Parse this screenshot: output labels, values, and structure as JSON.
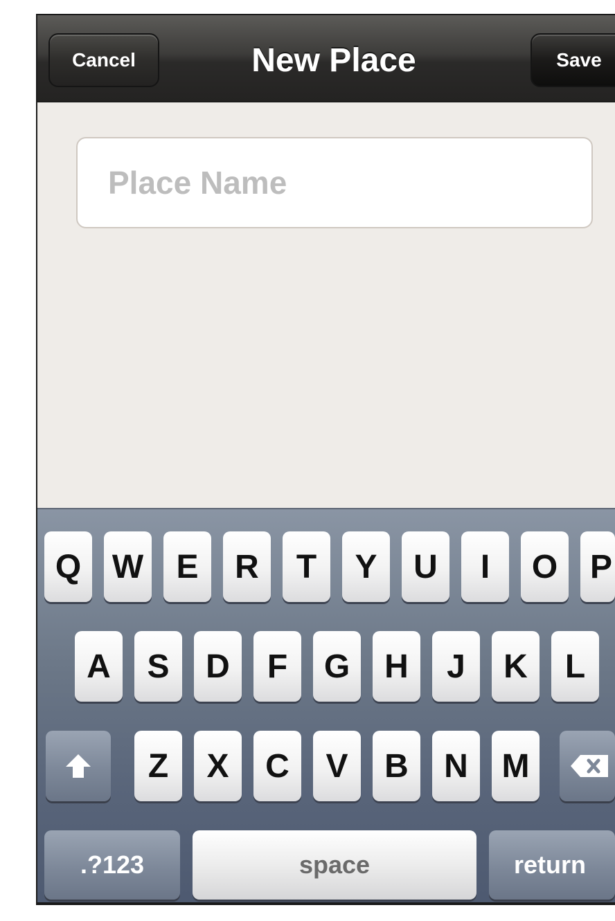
{
  "navbar": {
    "cancel_label": "Cancel",
    "title": "New Place",
    "save_label": "Save"
  },
  "form": {
    "place_name_value": "",
    "place_name_placeholder": "Place Name"
  },
  "keyboard": {
    "row1": [
      "Q",
      "W",
      "E",
      "R",
      "T",
      "Y",
      "U",
      "I",
      "O",
      "P"
    ],
    "row2": [
      "A",
      "S",
      "D",
      "F",
      "G",
      "H",
      "J",
      "K",
      "L"
    ],
    "row3": [
      "Z",
      "X",
      "C",
      "V",
      "B",
      "N",
      "M"
    ],
    "shift_icon": "shift-arrow-icon",
    "delete_icon": "backspace-icon",
    "numbers_label": ".?123",
    "space_label": "space",
    "return_label": "return"
  },
  "colors": {
    "navbar": "#2b2a29",
    "background": "#efece8",
    "keyboard": "#6b7787"
  }
}
